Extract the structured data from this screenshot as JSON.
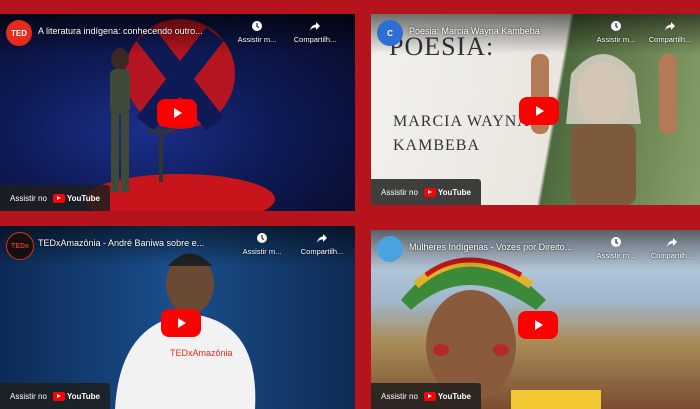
{
  "common": {
    "watch_label": "Assistir no",
    "youtube_label": "YouTube",
    "share_label": "Compartilh...",
    "watch_later_label": "Assistir m..."
  },
  "videos": [
    {
      "title": "A literatura indígena: conhecendo outro...",
      "channel_badge": "TED",
      "badge_color": "#e62b1e"
    },
    {
      "title": "Poesia: Marcia Wayna Kambeba",
      "channel_badge": "C",
      "badge_color": "#2d6fd1",
      "slide_heading": "POESIA:",
      "slide_name_line1": "MARCIA WAYNA",
      "slide_name_line2": "KAMBEBA"
    },
    {
      "title": "TEDxAmazônia - André Baniwa sobre e...",
      "channel_badge": "TEDx",
      "badge_color": "#e62b1e",
      "shirt_text": "TEDxAmazônia"
    },
    {
      "title": "Mulheres Indígenas - Vozes por Direito...",
      "channel_badge": "",
      "badge_color": "#4aa3df"
    }
  ]
}
